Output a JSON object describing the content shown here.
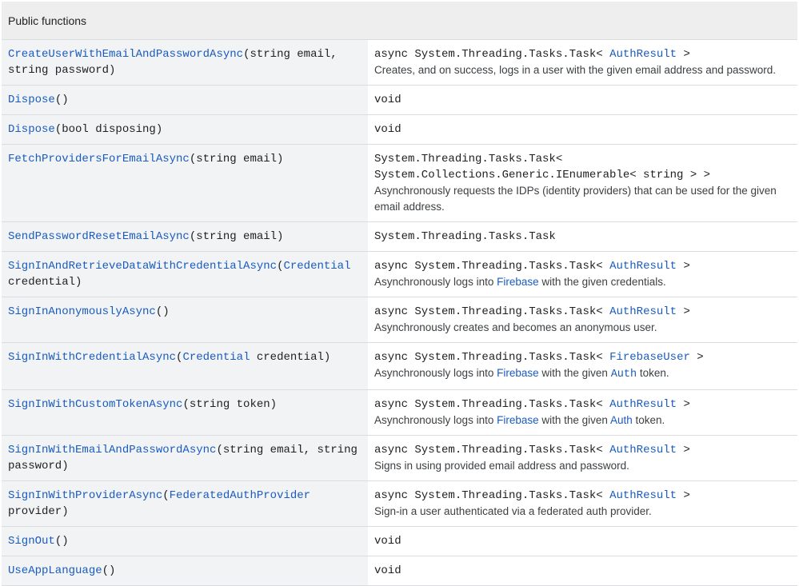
{
  "header": {
    "title": "Public functions"
  },
  "rows": [
    {
      "name": "CreateUserWithEmailAndPasswordAsync",
      "params": "(string email, string password)",
      "return_prefix": "async System.Threading.Tasks.Task< ",
      "return_link": "AuthResult",
      "return_suffix": " >",
      "desc": "Creates, and on success, logs in a user with the given email address and password."
    },
    {
      "name": "Dispose",
      "params": "()",
      "return_plain": "void"
    },
    {
      "name": "Dispose",
      "params": "(bool disposing)",
      "return_plain": "void"
    },
    {
      "name": "FetchProvidersForEmailAsync",
      "params": "(string email)",
      "return_line1": "System.Threading.Tasks.Task<",
      "return_line2": "System.Collections.Generic.IEnumerable< string > >",
      "desc": "Asynchronously requests the IDPs (identity providers) that can be used for the given email address."
    },
    {
      "name": "SendPasswordResetEmailAsync",
      "params": "(string email)",
      "return_plain": "System.Threading.Tasks.Task"
    },
    {
      "name": "SignInAndRetrieveDataWithCredentialAsync",
      "params_open": "(",
      "param_link": "Credential",
      "params_close": " credential)",
      "return_prefix": "async System.Threading.Tasks.Task< ",
      "return_link": "AuthResult",
      "return_suffix": " >",
      "desc_before": "Asynchronously logs into ",
      "desc_link": "Firebase",
      "desc_after": " with the given credentials."
    },
    {
      "name": "SignInAnonymouslyAsync",
      "params": "()",
      "return_prefix": "async System.Threading.Tasks.Task< ",
      "return_link": "AuthResult",
      "return_suffix": " >",
      "desc": "Asynchronously creates and becomes an anonymous user."
    },
    {
      "name": "SignInWithCredentialAsync",
      "params_open": "(",
      "param_link": "Credential",
      "params_close": " credential)",
      "return_prefix": "async System.Threading.Tasks.Task< ",
      "return_link": "FirebaseUser",
      "return_suffix": " >",
      "desc_before": "Asynchronously logs into ",
      "desc_link": "Firebase",
      "desc_mid": " with the given ",
      "desc_link2": "Auth",
      "desc_after": " token."
    },
    {
      "name": "SignInWithCustomTokenAsync",
      "params": "(string token)",
      "return_prefix": "async System.Threading.Tasks.Task< ",
      "return_link": "AuthResult",
      "return_suffix": " >",
      "desc_before": "Asynchronously logs into ",
      "desc_link": "Firebase",
      "desc_mid": " with the given ",
      "desc_link2": "Auth",
      "desc_after": " token."
    },
    {
      "name": "SignInWithEmailAndPasswordAsync",
      "params": "(string email, string password)",
      "return_prefix": "async System.Threading.Tasks.Task< ",
      "return_link": "AuthResult",
      "return_suffix": " >",
      "desc": "Signs in using provided email address and password."
    },
    {
      "name": "SignInWithProviderAsync",
      "params_open": "(",
      "param_link": "FederatedAuthProvider",
      "params_close": " provider)",
      "return_prefix": "async System.Threading.Tasks.Task< ",
      "return_link": "AuthResult",
      "return_suffix": " >",
      "desc": "Sign-in a user authenticated via a federated auth provider."
    },
    {
      "name": "SignOut",
      "params": "()",
      "return_plain": "void"
    },
    {
      "name": "UseAppLanguage",
      "params": "()",
      "return_plain": "void"
    }
  ]
}
